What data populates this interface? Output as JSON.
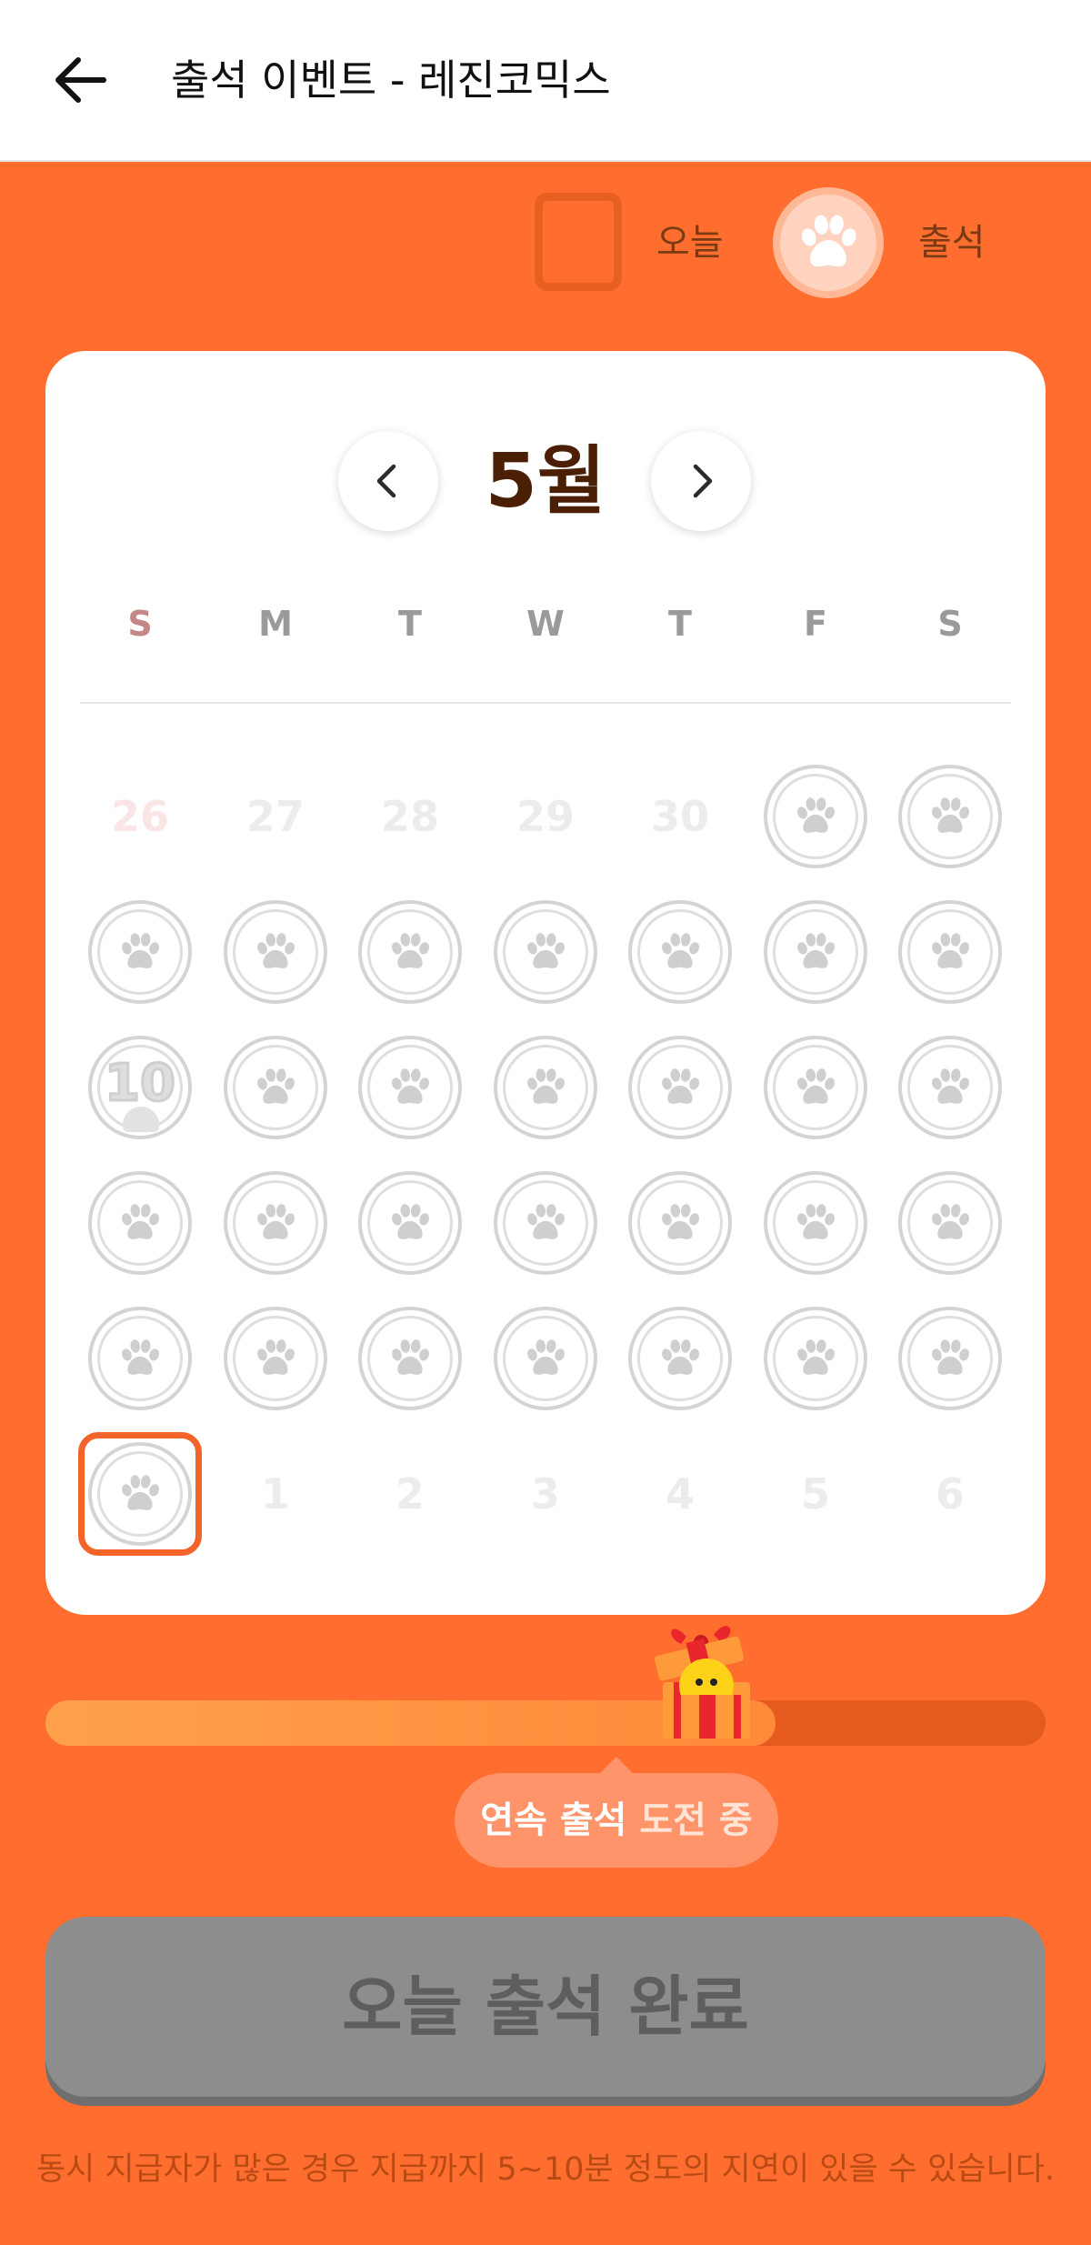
{
  "header": {
    "title": "출석 이벤트 - 레진코믹스",
    "back_icon": "arrow-left-icon"
  },
  "legend": {
    "today_label": "오늘",
    "attend_label": "출석",
    "attend_icon": "paw-icon"
  },
  "calendar": {
    "month_label": "5월",
    "prev_icon": "chevron-left-icon",
    "next_icon": "chevron-right-icon",
    "weekdays": [
      "S",
      "M",
      "T",
      "W",
      "T",
      "F",
      "S"
    ],
    "stamp_icon": "paw-icon",
    "milestone_label": "10",
    "leading_days": [
      "26",
      "27",
      "28",
      "29",
      "30"
    ],
    "trailing_days": [
      "1",
      "2",
      "3",
      "4",
      "5",
      "6"
    ],
    "days_in_month": 31,
    "today": 31,
    "milestone_day": 10
  },
  "progress": {
    "fraction": 0.73,
    "gift_icon": "gift-icon"
  },
  "challenge": {
    "highlight": "연속 출석",
    "rest": "도전 중"
  },
  "complete_button_label": "오늘 출석 완료",
  "notice": "동시 지급자가 많은 경우 지급까지 5~10분 정도의 지연이 있을 수 있습니다.",
  "colors": {
    "background": "#ff6d2f",
    "card": "#ffffff",
    "month_text": "#4a1f06",
    "stamp_gray": "#d4d4d4",
    "button_disabled": "#8d8d8d"
  }
}
